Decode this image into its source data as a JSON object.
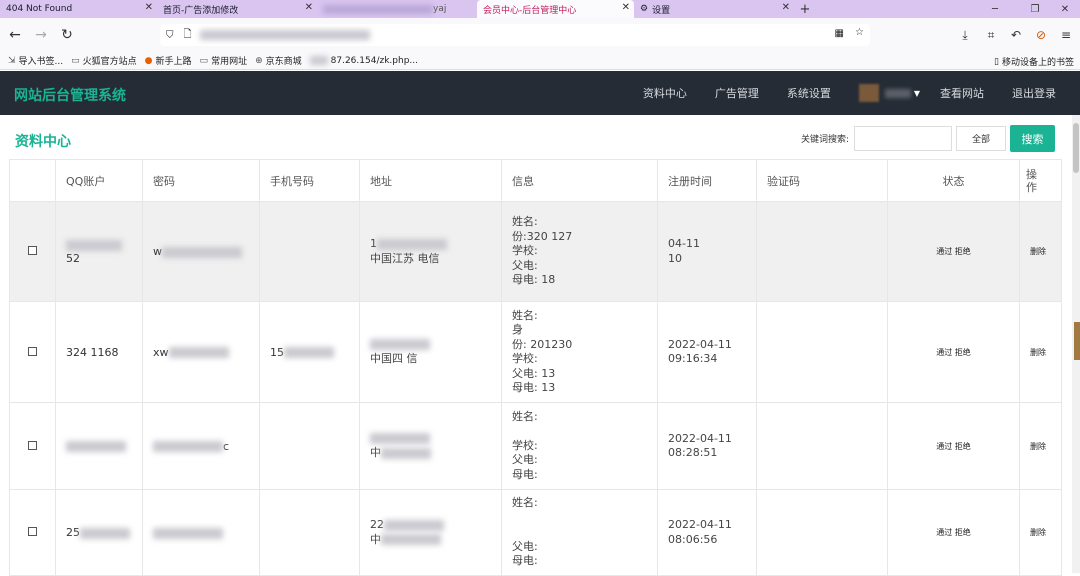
{
  "browser": {
    "tabs": [
      {
        "title": "404 Not Found",
        "active": false
      },
      {
        "title": "首页-广告添加修改",
        "active": false
      },
      {
        "title": "yaj",
        "active": false
      },
      {
        "title": "会员中心-后台管理中心",
        "active": true
      },
      {
        "title": "设置",
        "active": false
      }
    ],
    "url_visible": "zk.php...",
    "bookmarks": [
      "导入书签...",
      "火狐官方站点",
      "新手上路",
      "常用网址",
      "京东商城",
      "87.26.154/zk.php..."
    ],
    "bookmarks_right": "移动设备上的书签"
  },
  "app": {
    "brand": "网站后台管理系统",
    "nav": [
      "资料中心",
      "广告管理",
      "系统设置",
      "查看网站",
      "退出登录"
    ],
    "page_title": "资料中心",
    "search": {
      "label": "关键词搜索:",
      "value": "",
      "select": "全部",
      "button": "搜索"
    },
    "columns": [
      "",
      "QQ账户",
      "密码",
      "手机号码",
      "地址",
      "信息",
      "注册时间",
      "验证码",
      "状态",
      "操\n作"
    ],
    "rows": [
      {
        "qq": "52",
        "password": "w",
        "phone": "",
        "address": [
          "1",
          "中国江苏 电信"
        ],
        "info": [
          "姓名:",
          "份:320 127",
          "学校:",
          "父电:",
          "母电: 18"
        ],
        "time": [
          "04-11",
          "10"
        ],
        "status": [
          "通过",
          "拒绝"
        ],
        "action": "删除"
      },
      {
        "qq": "324 1168",
        "password": "xw",
        "phone": "15",
        "address": [
          "",
          "中国四 信"
        ],
        "info": [
          "姓名:",
          "身",
          "份: 201230",
          "学校:",
          "父电: 13",
          "母电: 13"
        ],
        "time": [
          "2022-04-11",
          "09:16:34"
        ],
        "status": [
          "通过",
          "拒绝"
        ],
        "action": "删除"
      },
      {
        "qq": "",
        "password": "c",
        "phone": "",
        "address": [
          "",
          "中"
        ],
        "info": [
          "姓名:",
          "",
          "学校:",
          "父电:",
          "母电:"
        ],
        "time": [
          "2022-04-11",
          "08:28:51"
        ],
        "status": [
          "通过",
          "拒绝"
        ],
        "action": "删除"
      },
      {
        "qq": "25",
        "password": "",
        "phone": "",
        "address": [
          "22",
          "中"
        ],
        "info": [
          "姓名:",
          "",
          "",
          "父电:",
          "母电:"
        ],
        "time": [
          "2022-04-11",
          "08:06:56"
        ],
        "status": [
          "通过",
          "拒绝"
        ],
        "action": "删除"
      }
    ]
  }
}
